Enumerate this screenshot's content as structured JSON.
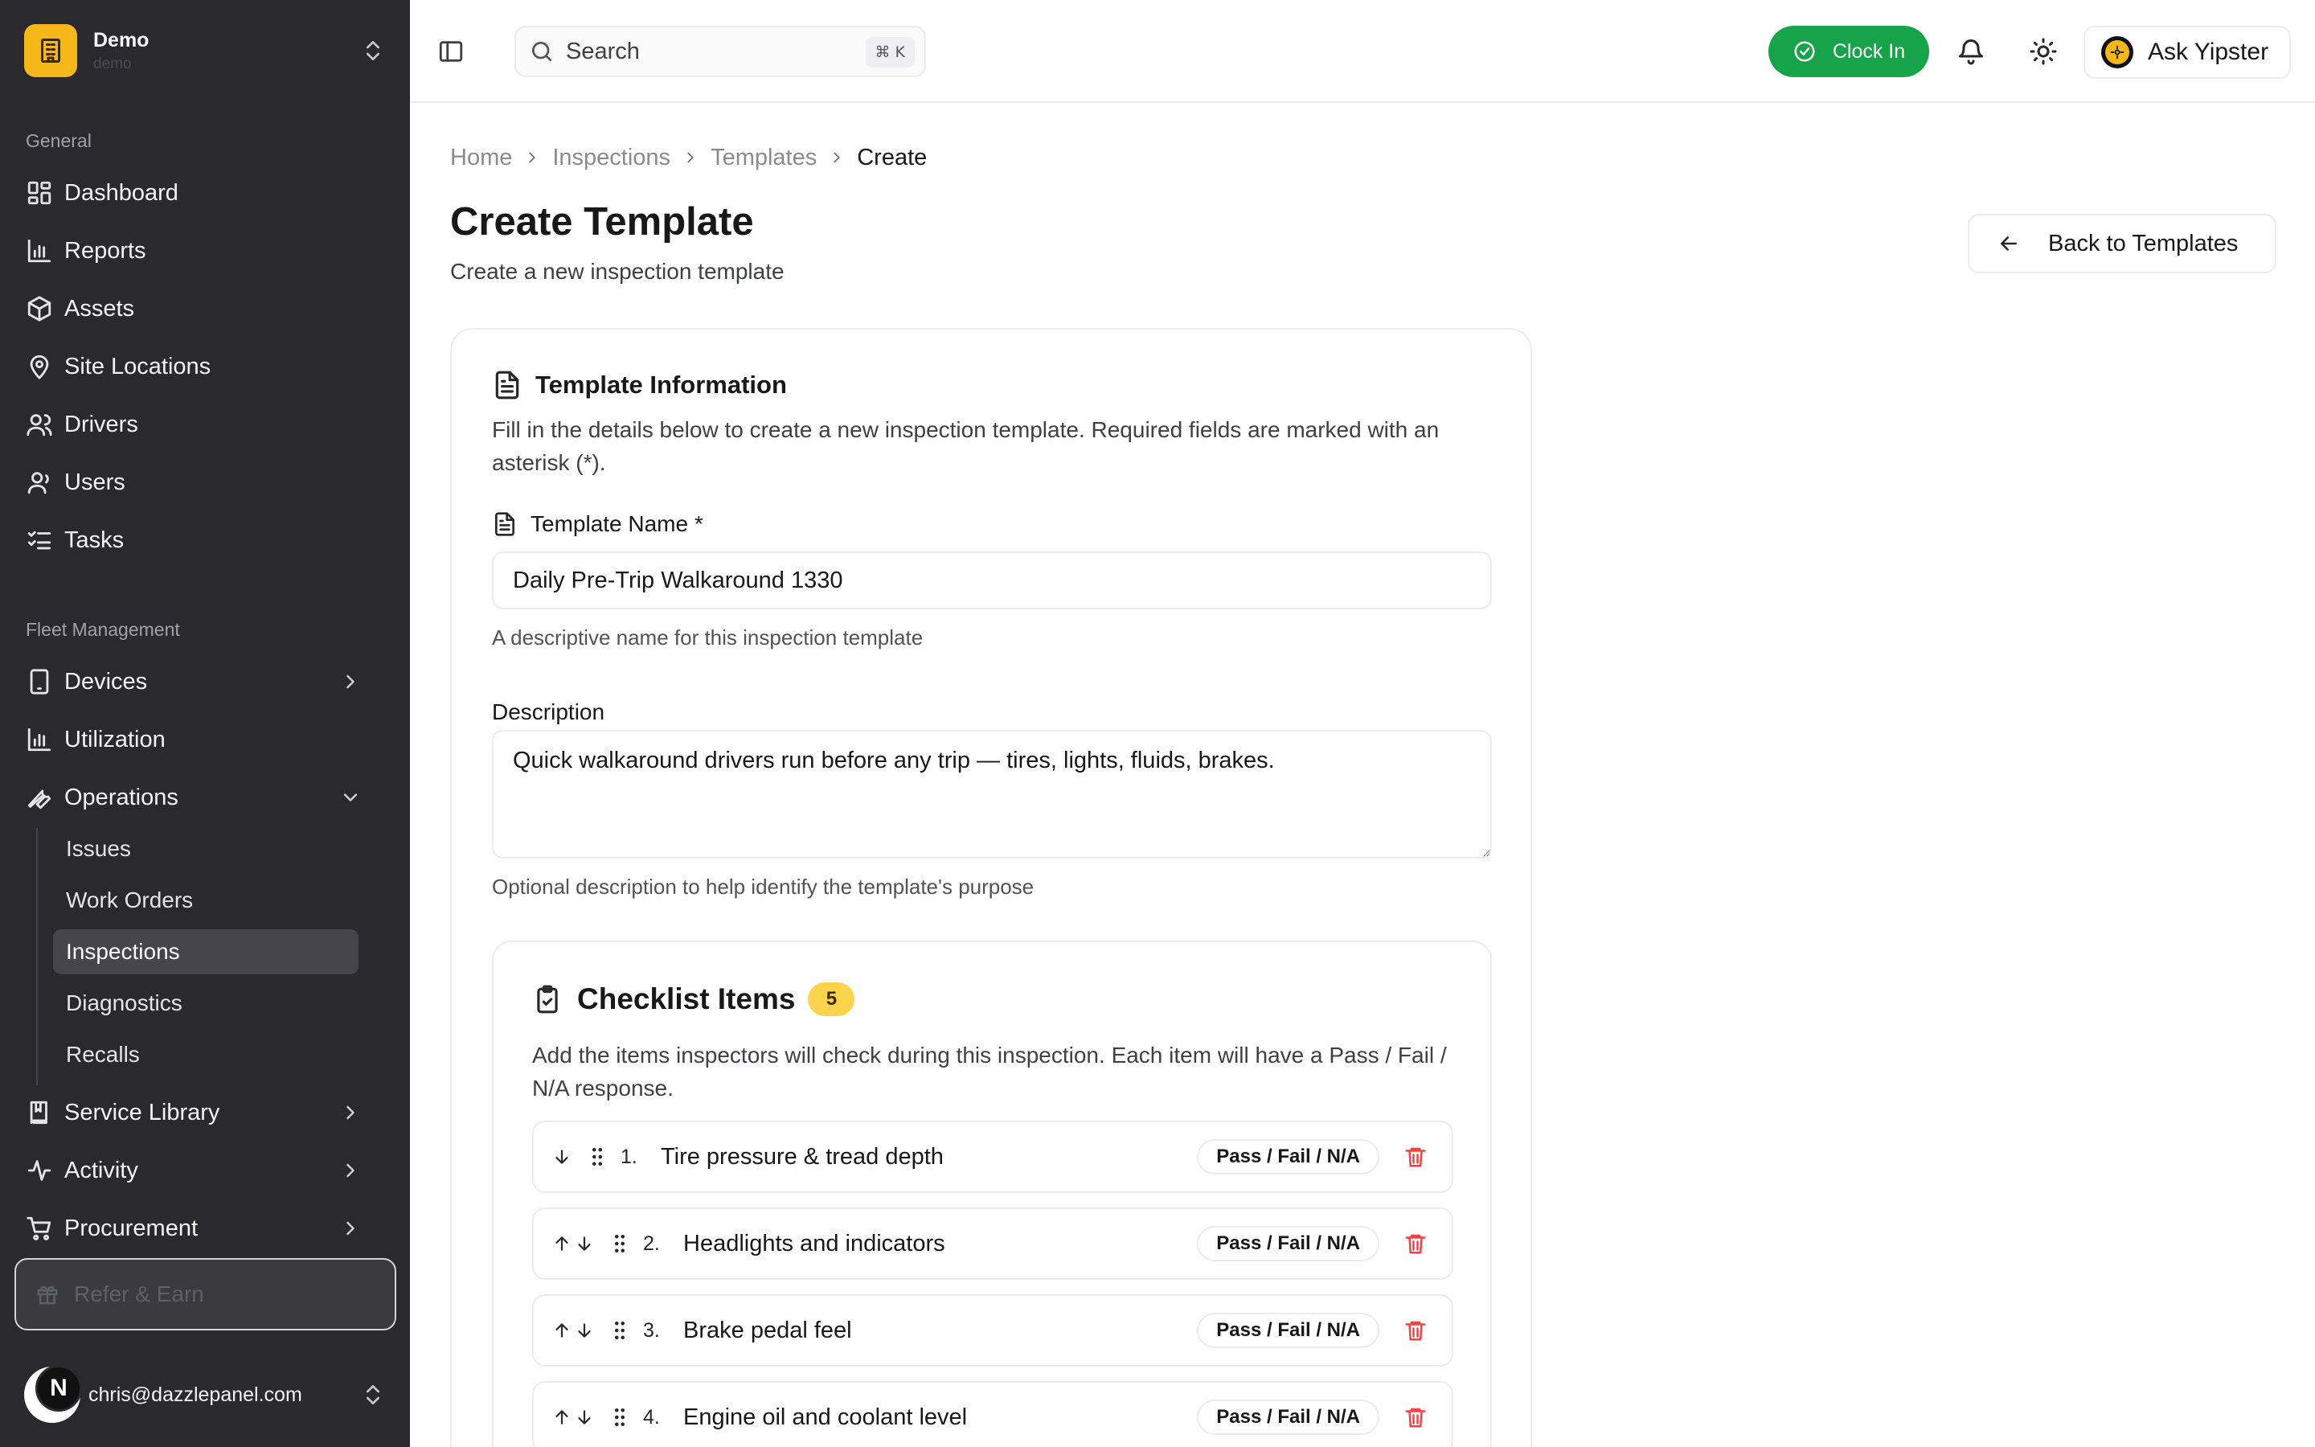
{
  "org": {
    "name": "Demo",
    "slug": "demo"
  },
  "sidebar": {
    "general_label": "General",
    "general_items": [
      {
        "label": "Dashboard",
        "icon": "dashboard-icon"
      },
      {
        "label": "Reports",
        "icon": "bar-chart-icon"
      },
      {
        "label": "Assets",
        "icon": "package-icon"
      },
      {
        "label": "Site Locations",
        "icon": "map-pin-icon"
      },
      {
        "label": "Drivers",
        "icon": "users-icon"
      },
      {
        "label": "Users",
        "icon": "user-icon"
      },
      {
        "label": "Tasks",
        "icon": "list-checks-icon"
      }
    ],
    "fleet_label": "Fleet Management",
    "fleet_items": [
      {
        "label": "Devices",
        "icon": "tablet-icon",
        "expanded": false
      },
      {
        "label": "Utilization",
        "icon": "bar-chart-icon",
        "expanded": false
      },
      {
        "label": "Operations",
        "icon": "wrench-icon",
        "expanded": true
      },
      {
        "label": "Service Library",
        "icon": "book-icon",
        "expanded": false
      },
      {
        "label": "Activity",
        "icon": "activity-icon",
        "expanded": false
      },
      {
        "label": "Procurement",
        "icon": "cart-icon",
        "expanded": false
      }
    ],
    "operations_sub": [
      "Issues",
      "Work Orders",
      "Inspections",
      "Diagnostics",
      "Recalls"
    ],
    "active_sub": "Inspections",
    "refer_label": "Refer & Earn",
    "user_initial": "N",
    "user_email": "chris@dazzlepanel.com"
  },
  "topbar": {
    "search_placeholder": "Search",
    "search_shortcut": "⌘ K",
    "clock_in_label": "Clock In",
    "ask_label": "Ask Yipster"
  },
  "breadcrumb": [
    "Home",
    "Inspections",
    "Templates",
    "Create"
  ],
  "page": {
    "title": "Create Template",
    "subtitle": "Create a new inspection template",
    "back_label": "Back to Templates"
  },
  "template_info": {
    "title": "Template Information",
    "description": "Fill in the details below to create a new inspection template. Required fields are marked with an asterisk (*).",
    "name_label": "Template Name *",
    "name_value": "Daily Pre-Trip Walkaround 1330",
    "name_help": "A descriptive name for this inspection template",
    "desc_label": "Description",
    "desc_value": "Quick walkaround drivers run before any trip — tires, lights, fluids, brakes.",
    "desc_help": "Optional description to help identify the template's purpose"
  },
  "checklist": {
    "title": "Checklist Items",
    "count": "5",
    "description": "Add the items inspectors will check during this inspection. Each item will have a Pass / Fail / N/A response.",
    "response_label": "Pass / Fail / N/A",
    "items": [
      {
        "num": "1.",
        "text": "Tire pressure & tread depth"
      },
      {
        "num": "2.",
        "text": "Headlights and indicators"
      },
      {
        "num": "3.",
        "text": "Brake pedal feel"
      },
      {
        "num": "4.",
        "text": "Engine oil and coolant level"
      }
    ]
  },
  "colors": {
    "sidebar_bg": "#2a2a2e",
    "brand": "#f5b71a",
    "clock_in": "#16a34a",
    "badge": "#fcd34d",
    "danger": "#ef4444"
  }
}
